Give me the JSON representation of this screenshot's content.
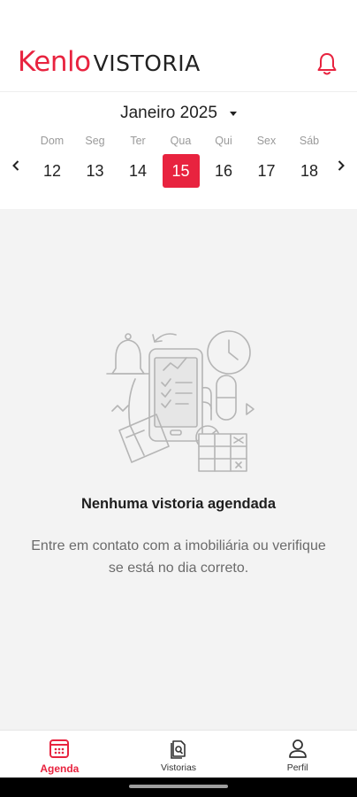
{
  "header": {
    "brand_primary": "Kenlo",
    "brand_secondary": "VISTORIA",
    "notification_icon": "bell-icon",
    "accent_color": "#e8233f"
  },
  "calendar": {
    "month_label": "Janeiro 2025",
    "prev_icon": "chevron-left-icon",
    "next_icon": "chevron-right-icon",
    "days": [
      {
        "name": "Dom",
        "number": "12"
      },
      {
        "name": "Seg",
        "number": "13"
      },
      {
        "name": "Ter",
        "number": "14"
      },
      {
        "name": "Qua",
        "number": "15",
        "selected": true
      },
      {
        "name": "Qui",
        "number": "16"
      },
      {
        "name": "Sex",
        "number": "17"
      },
      {
        "name": "Sáb",
        "number": "18"
      }
    ]
  },
  "empty_state": {
    "illustration": "phone-checklist-illustration",
    "title": "Nenhuma vistoria agendada",
    "description": "Entre em contato com a imobiliária ou verifique se está no dia correto."
  },
  "bottom_nav": {
    "items": [
      {
        "label": "Agenda",
        "icon": "calendar-icon",
        "active": true
      },
      {
        "label": "Vistorias",
        "icon": "document-search-icon",
        "active": false
      },
      {
        "label": "Perfil",
        "icon": "user-icon",
        "active": false
      }
    ]
  }
}
